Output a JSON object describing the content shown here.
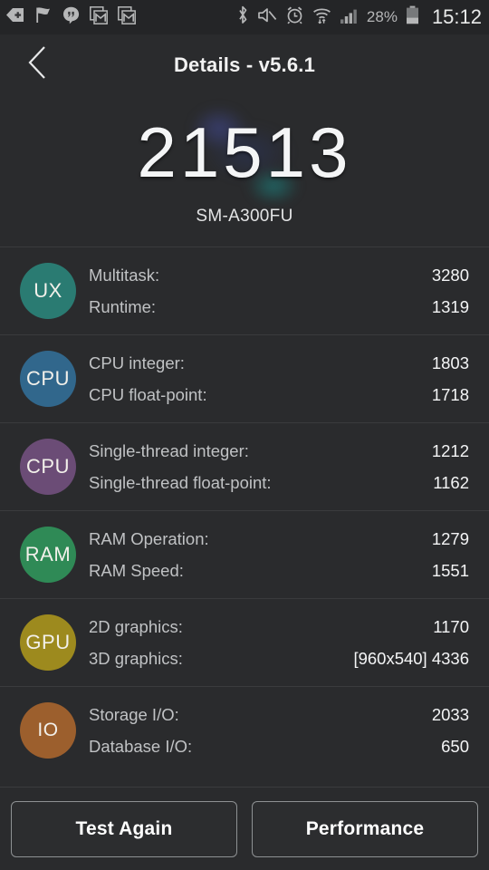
{
  "status_bar": {
    "left_icons": [
      "download-plus-icon",
      "flag-icon",
      "hangouts-icon",
      "gmail-icon",
      "gmail-icon"
    ],
    "right_icons": [
      "bluetooth-icon",
      "mute-icon",
      "alarm-icon",
      "wifi-icon",
      "signal-icon"
    ],
    "battery_percent": "28%",
    "clock": "15:12"
  },
  "header": {
    "back_icon": "chevron-left-icon",
    "title": "Details - v5.6.1"
  },
  "summary": {
    "score": "21513",
    "device": "SM-A300FU"
  },
  "results": [
    {
      "badge": "UX",
      "color": "#2a7b72",
      "lines": [
        {
          "label": "Multitask:",
          "value": "3280"
        },
        {
          "label": "Runtime:",
          "value": "1319"
        }
      ]
    },
    {
      "badge": "CPU",
      "color": "#31678c",
      "lines": [
        {
          "label": "CPU integer:",
          "value": "1803"
        },
        {
          "label": "CPU float-point:",
          "value": "1718"
        }
      ]
    },
    {
      "badge": "CPU",
      "color": "#6b4c76",
      "lines": [
        {
          "label": "Single-thread integer:",
          "value": "1212"
        },
        {
          "label": "Single-thread float-point:",
          "value": "1162"
        }
      ]
    },
    {
      "badge": "RAM",
      "color": "#2f8a56",
      "lines": [
        {
          "label": "RAM Operation:",
          "value": "1279"
        },
        {
          "label": "RAM Speed:",
          "value": "1551"
        }
      ]
    },
    {
      "badge": "GPU",
      "color": "#9d8a1e",
      "lines": [
        {
          "label": "2D graphics:",
          "value": "1170"
        },
        {
          "label": "3D graphics:",
          "value": "[960x540] 4336"
        }
      ]
    },
    {
      "badge": "IO",
      "color": "#9c5f2d",
      "lines": [
        {
          "label": "Storage I/O:",
          "value": "2033"
        },
        {
          "label": "Database I/O:",
          "value": "650"
        }
      ]
    }
  ],
  "footer": {
    "test_again_label": "Test Again",
    "performance_label": "Performance"
  }
}
